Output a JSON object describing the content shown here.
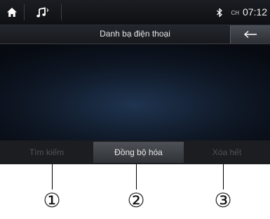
{
  "statusbar": {
    "home_icon": "home-icon",
    "music_icon": "music-note-icon",
    "bluetooth_icon": "bluetooth-icon",
    "ampm": "CH",
    "time": "07:12"
  },
  "header": {
    "title": "Danh bạ điện thoại",
    "back_icon": "arrow-left-icon"
  },
  "bottom_tabs": [
    {
      "label": "Tìm kiếm",
      "state": "disabled"
    },
    {
      "label": "Đồng bộ hóa",
      "state": "active"
    },
    {
      "label": "Xóa hết",
      "state": "disabled"
    }
  ],
  "callouts": [
    "①",
    "②",
    "③"
  ],
  "colors": {
    "background": "#0f1826",
    "active_tab": "#4e5258",
    "disabled_text": "#4e5157"
  }
}
